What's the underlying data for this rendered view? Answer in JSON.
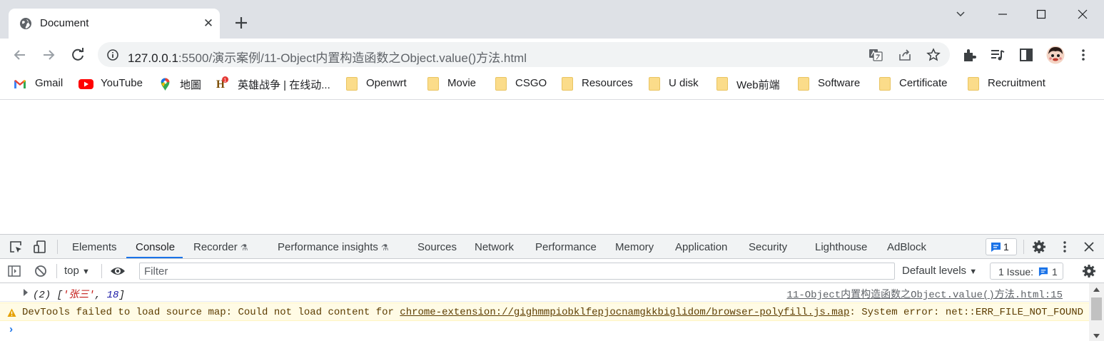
{
  "browser": {
    "tab": {
      "title": "Document"
    },
    "url": {
      "host": "127.0.0.1",
      "rest": ":5500/演示案例/11-Object内置构造函数之Object.value()方法.html"
    },
    "bookmarks": [
      {
        "label": "Gmail",
        "icon": "gmail-icon"
      },
      {
        "label": "YouTube",
        "icon": "youtube-icon"
      },
      {
        "label": "地圖",
        "icon": "maps-icon"
      },
      {
        "label": "英雄战争 | 在线动...",
        "icon": "game-icon"
      },
      {
        "label": "Openwrt",
        "icon": "folder-icon"
      },
      {
        "label": "Movie",
        "icon": "folder-icon"
      },
      {
        "label": "CSGO",
        "icon": "folder-icon"
      },
      {
        "label": "Resources",
        "icon": "folder-icon"
      },
      {
        "label": "U disk",
        "icon": "folder-icon"
      },
      {
        "label": "Web前端",
        "icon": "folder-icon"
      },
      {
        "label": "Software",
        "icon": "folder-icon"
      },
      {
        "label": "Certificate",
        "icon": "folder-icon"
      },
      {
        "label": "Recruitment",
        "icon": "folder-icon"
      }
    ]
  },
  "devtools": {
    "tabs": [
      "Elements",
      "Console",
      "Recorder",
      "Performance insights",
      "Sources",
      "Network",
      "Performance",
      "Memory",
      "Application",
      "Security",
      "Lighthouse",
      "AdBlock"
    ],
    "active_tab": "Console",
    "messages_badge": "1",
    "context": "top",
    "filter_placeholder": "Filter",
    "levels": "Default levels",
    "issues_label": "1 Issue:",
    "issues_count": "1",
    "console": {
      "log1": {
        "prefix": "(2) [",
        "str": "'张三'",
        "sep": ", ",
        "num": "18",
        "suffix": "]",
        "source": "11-Object内置构造函数之Object.value()方法.html:15"
      },
      "warning": {
        "before": "DevTools failed to load source map: Could not load content for ",
        "link": "chrome-extension://gighmmpiobklfepjocnamgkkbiglidom/browser-polyfill.js.map",
        "after": ": System error: net::ERR_FILE_NOT_FOUND"
      },
      "prompt": "›"
    }
  },
  "colors": {
    "accent": "#1a73e8",
    "warning_bg": "#fffbe5",
    "tabstrip": "#dee1e6"
  }
}
